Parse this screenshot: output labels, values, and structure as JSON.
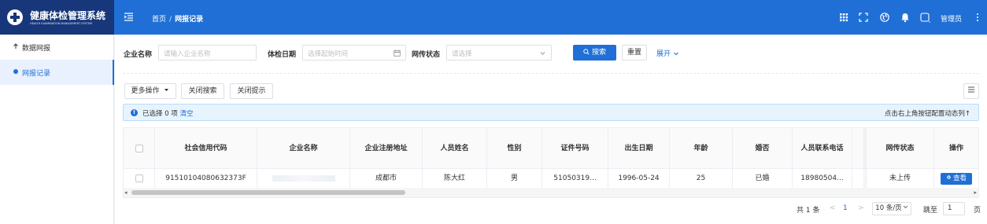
{
  "header": {
    "app_title": "健康体检管理系统",
    "app_subtitle": "HEALTH EXAMINATION MANAGEMENT SYSTEM",
    "breadcrumb": [
      "首页",
      "网报记录"
    ],
    "breadcrumb_sep": "/",
    "user_name": "管理员",
    "icons": [
      "grid-icon",
      "fullscreen-icon",
      "globe-icon",
      "bell-icon",
      "avatar-icon",
      "more-vertical-icon"
    ]
  },
  "sidebar": {
    "items": [
      {
        "label": "数据网报",
        "icon": "upload-arrow-icon",
        "active": false
      },
      {
        "label": "网报记录",
        "icon": "dot-icon",
        "active": true
      }
    ]
  },
  "filters": {
    "company_label": "企业名称",
    "company_placeholder": "请输入企业名称",
    "date_label": "体检日期",
    "date_placeholder": "选择起始时间",
    "status_label": "网传状态",
    "status_placeholder": "请选择",
    "search_label": "搜索",
    "reset_label": "重置",
    "expand_label": "展开"
  },
  "toolbar": {
    "more_label": "更多操作",
    "close_search_label": "关闭搜索",
    "close_tips_label": "关闭提示"
  },
  "alert": {
    "selected_prefix": "已选择 0 项",
    "clear_label": "清空",
    "hint": "点击右上角按钮配置动态列↑"
  },
  "table": {
    "columns": [
      "社会信用代码",
      "企业名称",
      "企业注册地址",
      "人员姓名",
      "性别",
      "证件号码",
      "出生日期",
      "年龄",
      "婚否",
      "人员联系电话",
      "网传状态",
      "操作"
    ],
    "rows": [
      {
        "credit_code": "91510104080632373F",
        "company": "",
        "address": "成都市",
        "name": "陈大红",
        "gender": "男",
        "id_no": "51050319...",
        "birth": "1996-05-24",
        "age": "25",
        "married": "已婚",
        "phone": "18980504...",
        "status": "未上传",
        "action": "查看"
      }
    ]
  },
  "pagination": {
    "total": "共 1 条",
    "current_page": "1",
    "page_size": "10 条/页",
    "jump_label": "跳至",
    "jump_value": "1",
    "page_unit": "页"
  },
  "colors": {
    "primary": "#1f6fd6",
    "logo_bg": "#17377a"
  }
}
